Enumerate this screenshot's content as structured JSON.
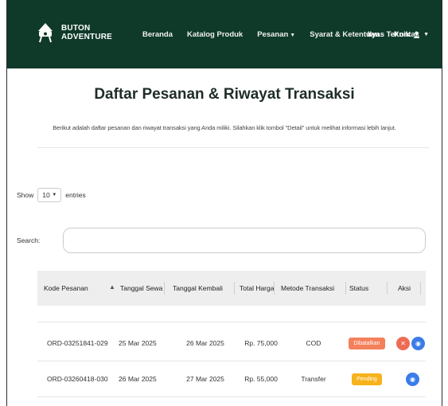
{
  "navbar": {
    "brand_line1": "BUTON",
    "brand_line2": "ADVENTURE",
    "links": [
      "Beranda",
      "Katalog Produk",
      "Pesanan",
      "Syarat & Ketentuan",
      "Kontak"
    ],
    "user": "Ilyas Teknik"
  },
  "page": {
    "title": "Daftar Pesanan & Riwayat Transaksi",
    "subtitle": "Berikut adalah daftar pesanan dan riwayat transaksi yang Anda miliki. Silahkan klik tombol \"Detail\" untuk melihat informasi lebih lanjut."
  },
  "table_controls": {
    "show_label": "Show",
    "entries_value": "10",
    "entries_label": "entries",
    "search_label": "Search:"
  },
  "table": {
    "headers": [
      "Kode Pesanan",
      "Tanggal Sewa",
      "Tanggal Kembali",
      "Total Harga",
      "Metode Transaksi",
      "Status",
      "Aksi"
    ],
    "rows": [
      {
        "kode": "ORD-03251841-029",
        "tgl_sewa": "25 Mar 2025",
        "tgl_kembali": "26 Mar 2025",
        "total": "Rp. 75,000",
        "metode": "COD",
        "status": "Dibatalkan",
        "status_color": "#f4805c",
        "actions": [
          "cancel-icon",
          "detail-icon"
        ]
      },
      {
        "kode": "ORD-03260418-030",
        "tgl_sewa": "26 Mar 2025",
        "tgl_kembali": "27 Mar 2025",
        "total": "Rp. 55,000",
        "metode": "Transfer",
        "status": "Pending",
        "status_color": "#f7b21c",
        "actions": [
          "detail-icon"
        ]
      }
    ]
  },
  "colors": {
    "navbar": "#0f3a2a",
    "header_row": "#eeeeee",
    "action_red": "#ee6b55",
    "action_blue": "#3b7ce8"
  }
}
